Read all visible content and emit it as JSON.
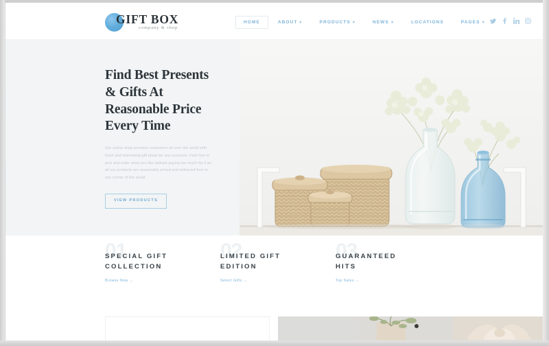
{
  "header": {
    "logo": {
      "name": "GIFT BOX",
      "tagline": "company & shop",
      "mark": "circle-gradient-logo-mark"
    },
    "nav": [
      {
        "label": "HOME",
        "active": true,
        "caret": ""
      },
      {
        "label": "ABOUT",
        "active": false,
        "caret": "▾"
      },
      {
        "label": "PRODUCTS",
        "active": false,
        "caret": "▾"
      },
      {
        "label": "NEWS",
        "active": false,
        "caret": "▾"
      },
      {
        "label": "LOCATIONS",
        "active": false,
        "caret": ""
      },
      {
        "label": "PAGES",
        "active": false,
        "caret": "▾"
      }
    ],
    "social": [
      {
        "name": "twitter-icon",
        "glyph": "✉"
      },
      {
        "name": "facebook-icon",
        "glyph": "f"
      },
      {
        "name": "linkedin-icon",
        "glyph": "in"
      },
      {
        "name": "instagram-icon",
        "glyph": "◎"
      }
    ]
  },
  "hero": {
    "title": "Find Best Presents\n& Gifts At\nReasonable Price\nEvery Time",
    "description": "Our online shop provides customers all over the world with fresh and interesting gift ideas for any occasion. Feel free to pick and order what you like without paying too much for it as all our products are reasonably priced and delivered free to any corner of the world.",
    "cta_label": "VIEW PRODUCTS",
    "image_alt": "wicker-baskets-and-glass-vases-with-babys-breath",
    "background_color": "#f2f4f5"
  },
  "features": [
    {
      "number": "01",
      "title": "SPECIAL GIFT\nCOLLECTION",
      "link_label": "Browse Now →"
    },
    {
      "number": "02",
      "title": "LIMITED GIFT\nEDITION",
      "link_label": "Select Gifts →"
    },
    {
      "number": "03",
      "title": "GUARANTEED\nHITS",
      "link_label": "Top Sales →"
    }
  ],
  "bottom": {
    "card_alt": "empty-content-card",
    "gallery": [
      {
        "alt": "gift-thumb-plain"
      },
      {
        "alt": "gift-thumb-plant-in-pot"
      },
      {
        "alt": "gift-thumb-fabric-bow"
      }
    ]
  },
  "colors": {
    "accent_blue": "#7db4da",
    "heading_dark": "#2d353b",
    "hero_bg": "#f2f4f5",
    "watermark": "#eef1f3"
  }
}
